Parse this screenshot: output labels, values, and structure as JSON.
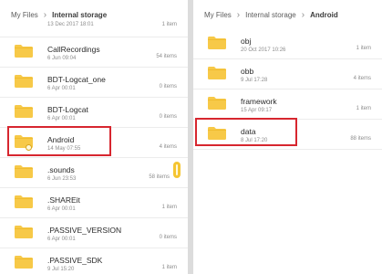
{
  "left_panel": {
    "breadcrumb": {
      "root": "My Files",
      "current": "Internal storage"
    },
    "partial_top": {
      "date": "13 Dec 2017 18:01",
      "count": "1 item"
    },
    "folders": [
      {
        "name": "CallRecordings",
        "date": "6 Jun 09:04",
        "count": "54 items"
      },
      {
        "name": "BDT-Logcat_one",
        "date": "6 Apr 00:01",
        "count": "0 items"
      },
      {
        "name": "BDT-Logcat",
        "date": "6 Apr 00:01",
        "count": "0 items"
      },
      {
        "name": "Android",
        "date": "14 May 07:55",
        "count": "4 items"
      },
      {
        "name": ".sounds",
        "date": "6 Jun 23:53",
        "count": "58 items"
      },
      {
        "name": ".SHAREit",
        "date": "6 Apr 00:01",
        "count": "1 item"
      },
      {
        "name": ".PASSIVE_VERSION",
        "date": "6 Apr 00:01",
        "count": "0 items"
      },
      {
        "name": ".PASSIVE_SDK",
        "date": "9 Jul 15:20",
        "count": "1 item"
      }
    ]
  },
  "right_panel": {
    "breadcrumb": {
      "root": "My Files",
      "middle": "Internal storage",
      "current": "Android"
    },
    "folders": [
      {
        "name": "obj",
        "date": "20 Oct 2017 10:26",
        "count": "1 item"
      },
      {
        "name": "obb",
        "date": "9 Jul 17:28",
        "count": "4 items"
      },
      {
        "name": "framework",
        "date": "15 Apr 09:17",
        "count": "1 item"
      },
      {
        "name": "data",
        "date": "8 Jul 17:20",
        "count": "88 items"
      }
    ]
  },
  "colors": {
    "folder": "#f7c948",
    "folder_tab": "#efb92a",
    "highlight": "#d7262f",
    "scrollbar": "#f5c532"
  },
  "icons": {
    "folder": "folder-icon",
    "chevron": "chevron-right-icon",
    "settings_badge": "gear-icon"
  }
}
